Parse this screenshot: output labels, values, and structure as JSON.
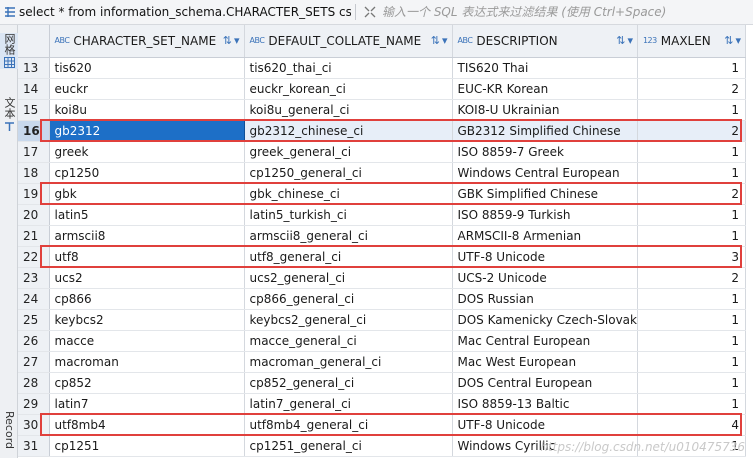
{
  "query": {
    "icon": "sql-query-icon",
    "text": "select * from information_schema.CHARACTER_SETS cs",
    "filter_icon": "filter-expand-icon",
    "filter_placeholder": "输入一个 SQL 表达式来过滤结果 (使用 Ctrl+Space)"
  },
  "sidebar": {
    "tabs": [
      {
        "label": "网格",
        "icon": "grid-icon",
        "active": true
      },
      {
        "label": "文本",
        "icon": "text-icon",
        "active": false
      },
      {
        "label": "Record",
        "icon": "record-icon",
        "active": false
      }
    ]
  },
  "columns": [
    {
      "type": "ABC",
      "name": "CHARACTER_SET_NAME"
    },
    {
      "type": "ABC",
      "name": "DEFAULT_COLLATE_NAME"
    },
    {
      "type": "ABC",
      "name": "DESCRIPTION"
    },
    {
      "type": "123",
      "name": "MAXLEN"
    }
  ],
  "rows": [
    {
      "n": "13",
      "name": "tis620",
      "collate": "tis620_thai_ci",
      "desc": "TIS620 Thai",
      "maxlen": "1"
    },
    {
      "n": "14",
      "name": "euckr",
      "collate": "euckr_korean_ci",
      "desc": "EUC-KR Korean",
      "maxlen": "2"
    },
    {
      "n": "15",
      "name": "koi8u",
      "collate": "koi8u_general_ci",
      "desc": "KOI8-U Ukrainian",
      "maxlen": "1"
    },
    {
      "n": "16",
      "name": "gb2312",
      "collate": "gb2312_chinese_ci",
      "desc": "GB2312 Simplified Chinese",
      "maxlen": "2"
    },
    {
      "n": "17",
      "name": "greek",
      "collate": "greek_general_ci",
      "desc": "ISO 8859-7 Greek",
      "maxlen": "1"
    },
    {
      "n": "18",
      "name": "cp1250",
      "collate": "cp1250_general_ci",
      "desc": "Windows Central European",
      "maxlen": "1"
    },
    {
      "n": "19",
      "name": "gbk",
      "collate": "gbk_chinese_ci",
      "desc": "GBK Simplified Chinese",
      "maxlen": "2"
    },
    {
      "n": "20",
      "name": "latin5",
      "collate": "latin5_turkish_ci",
      "desc": "ISO 8859-9 Turkish",
      "maxlen": "1"
    },
    {
      "n": "21",
      "name": "armscii8",
      "collate": "armscii8_general_ci",
      "desc": "ARMSCII-8 Armenian",
      "maxlen": "1"
    },
    {
      "n": "22",
      "name": "utf8",
      "collate": "utf8_general_ci",
      "desc": "UTF-8 Unicode",
      "maxlen": "3"
    },
    {
      "n": "23",
      "name": "ucs2",
      "collate": "ucs2_general_ci",
      "desc": "UCS-2 Unicode",
      "maxlen": "2"
    },
    {
      "n": "24",
      "name": "cp866",
      "collate": "cp866_general_ci",
      "desc": "DOS Russian",
      "maxlen": "1"
    },
    {
      "n": "25",
      "name": "keybcs2",
      "collate": "keybcs2_general_ci",
      "desc": "DOS Kamenicky Czech-Slovak",
      "maxlen": "1"
    },
    {
      "n": "26",
      "name": "macce",
      "collate": "macce_general_ci",
      "desc": "Mac Central European",
      "maxlen": "1"
    },
    {
      "n": "27",
      "name": "macroman",
      "collate": "macroman_general_ci",
      "desc": "Mac West European",
      "maxlen": "1"
    },
    {
      "n": "28",
      "name": "cp852",
      "collate": "cp852_general_ci",
      "desc": "DOS Central European",
      "maxlen": "1"
    },
    {
      "n": "29",
      "name": "latin7",
      "collate": "latin7_general_ci",
      "desc": "ISO 8859-13 Baltic",
      "maxlen": "1"
    },
    {
      "n": "30",
      "name": "utf8mb4",
      "collate": "utf8mb4_general_ci",
      "desc": "UTF-8 Unicode",
      "maxlen": "4"
    },
    {
      "n": "31",
      "name": "cp1251",
      "collate": "cp1251_general_ci",
      "desc": "Windows Cyrillic",
      "maxlen": "1"
    }
  ],
  "selected_row": "16",
  "highlighted_rows": [
    "16",
    "19",
    "22",
    "30"
  ],
  "colors": {
    "highlight": "#e0403c",
    "selection": "#1d6fc7",
    "accent": "#3b73b9"
  },
  "watermark": "https://blog.csdn.net/u010475736"
}
